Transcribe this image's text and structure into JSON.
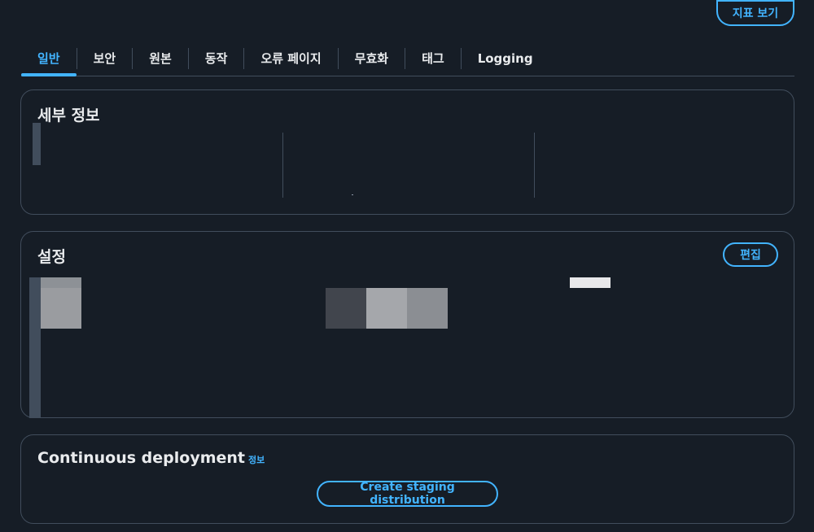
{
  "header": {
    "view_metrics_label": "지표 보기"
  },
  "tabs": [
    {
      "label": "일반",
      "active": true
    },
    {
      "label": "보안"
    },
    {
      "label": "원본"
    },
    {
      "label": "동작"
    },
    {
      "label": "오류 페이지"
    },
    {
      "label": "무효화"
    },
    {
      "label": "태그"
    },
    {
      "label": "Logging"
    }
  ],
  "details": {
    "title": "세부 정보"
  },
  "settings": {
    "title": "설정",
    "edit_label": "편집"
  },
  "continuous_deployment": {
    "title": "Continuous deployment",
    "info_label": "정보",
    "create_staging_label": "Create staging distribution"
  },
  "colors": {
    "accent": "#42b4ff",
    "background": "#161d26",
    "border": "#414d5c"
  }
}
